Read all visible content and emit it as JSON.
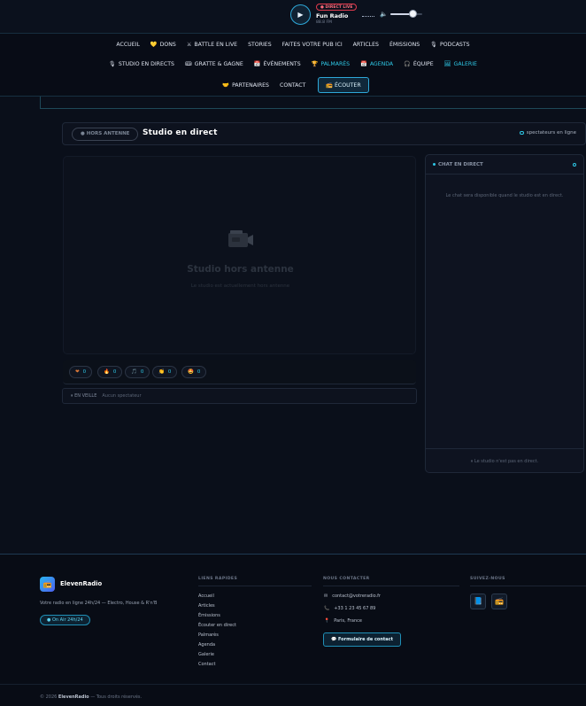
{
  "player": {
    "play_glyph": "▶",
    "live_badge": "● DIRECT LIVE",
    "station": "Fun Radio",
    "frequency": "88.8 FM",
    "volume_glyph": "🔈",
    "volume_level": 0.65
  },
  "nav": {
    "row1": [
      {
        "icon": "",
        "label": "ACCUEIL"
      },
      {
        "icon": "💛",
        "label": "DONS"
      },
      {
        "icon": "⚔",
        "label": "BATTLE EN LIVE"
      },
      {
        "icon": "",
        "label": "STORIES"
      },
      {
        "icon": "",
        "label": "FAITES VOTRE PUB ICI"
      },
      {
        "icon": "",
        "label": "ARTICLES"
      },
      {
        "icon": "",
        "label": "ÉMISSIONS"
      },
      {
        "icon": "🎙",
        "label": "PODCASTS"
      }
    ],
    "row2": [
      {
        "icon": "🎙",
        "label": "STUDIO EN DIRECTS"
      },
      {
        "icon": "🎟",
        "label": "GRATTE & GAGNE"
      },
      {
        "icon": "📅",
        "label": "ÉVÉNEMENTS"
      },
      {
        "icon": "🏆",
        "label": "PALMARÈS"
      },
      {
        "icon": "📅",
        "label": "AGENDA"
      },
      {
        "icon": "🎧",
        "label": "ÉQUIPE"
      },
      {
        "icon": "🖼",
        "label": "GALERIE"
      }
    ],
    "row3": [
      {
        "icon": "🤝",
        "label": "PARTENAIRES"
      },
      {
        "icon": "",
        "label": "CONTACT"
      }
    ],
    "listen_button": "📻 ÉCOUTER"
  },
  "studio": {
    "status_pill": "● HORS ANTENNE",
    "title": "Studio en direct",
    "viewers": "spectateurs en ligne",
    "offline_title": "Studio hors antenne",
    "offline_subtitle": "Le studio est actuellement hors antenne",
    "reactions": [
      {
        "icon": "❤",
        "count": "0"
      },
      {
        "icon": "🔥",
        "count": "0"
      },
      {
        "icon": "🎵",
        "count": "0"
      },
      {
        "icon": "👏",
        "count": "0"
      },
      {
        "icon": "🤩",
        "count": "0"
      }
    ],
    "idle_label": "⏸ EN VEILLE",
    "idle_text": "Aucun spectateur"
  },
  "chat": {
    "title": "CHAT EN DIRECT",
    "message": "Le chat sera disponible quand le studio est en direct.",
    "footer": "⏸ Le studio n'est pas en direct."
  },
  "footer": {
    "brand_icon": "📻",
    "brand": "ElevenRadio",
    "tagline": "Votre radio en ligne 24h/24 — Electro, House & R'n'B",
    "onair": "● On Air 24h/24",
    "links_heading": "LIENS RAPIDES",
    "links": [
      "Accueil",
      "Articles",
      "Émissions",
      "Écouter en direct",
      "Palmarès",
      "Agenda",
      "Galerie",
      "Contact"
    ],
    "contact_heading": "NOUS CONTACTER",
    "contact": [
      {
        "icon": "✉",
        "text": "contact@votreradio.fr"
      },
      {
        "icon": "📞",
        "text": "+33 1 23 45 67 89"
      },
      {
        "icon": "📍",
        "text": "Paris, France"
      }
    ],
    "form_button": "💬 Formulaire de contact",
    "social_heading": "SUIVEZ-NOUS",
    "social": [
      {
        "icon": "📘"
      },
      {
        "icon": "📻"
      }
    ],
    "copyright_prefix": "© 2026",
    "copyright_brand": "ElevenRadio",
    "copyright_suffix": "— Tous droits réservés."
  }
}
